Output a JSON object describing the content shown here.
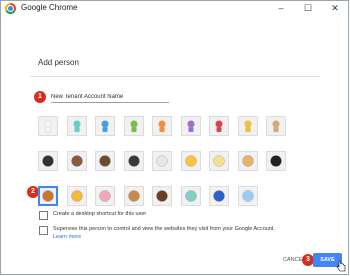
{
  "window": {
    "title": "Google Chrome",
    "controls": {
      "minimize": "–",
      "maximize": "☐",
      "close": "✕"
    }
  },
  "dialog": {
    "title": "Add person"
  },
  "name_input": {
    "value": "New Tenant Account Name"
  },
  "steps": {
    "one": "1",
    "two": "2",
    "three": "3"
  },
  "avatars": [
    {
      "icon": "white-silhouette-icon",
      "color": "#f5f5f5"
    },
    {
      "icon": "teal-silhouette-icon",
      "color": "#5fd1c4"
    },
    {
      "icon": "blue-silhouette-icon",
      "color": "#3aa0f0"
    },
    {
      "icon": "green-silhouette-icon",
      "color": "#6fc247"
    },
    {
      "icon": "orange-silhouette-icon",
      "color": "#f58c3a"
    },
    {
      "icon": "purple-silhouette-icon",
      "color": "#9b6bd6"
    },
    {
      "icon": "red-silhouette-icon",
      "color": "#e33b4a"
    },
    {
      "icon": "yellow-silhouette-icon",
      "color": "#f2c230"
    },
    {
      "icon": "tan-person-icon",
      "color": "#d8a86f"
    },
    {
      "icon": "detective-icon",
      "color": "#333333"
    },
    {
      "icon": "mustache-man-icon",
      "color": "#8a5a3c"
    },
    {
      "icon": "bearded-man-icon",
      "color": "#6b4c2f"
    },
    {
      "icon": "ninja-icon",
      "color": "#3a3a3a"
    },
    {
      "icon": "alien-icon",
      "color": "#e6e6e6"
    },
    {
      "icon": "smiley-icon",
      "color": "#f5c542"
    },
    {
      "icon": "flower-icon",
      "color": "#f4e28a"
    },
    {
      "icon": "pizza-icon",
      "color": "#e8b26b"
    },
    {
      "icon": "soccer-ball-icon",
      "color": "#222222"
    },
    {
      "icon": "burger-icon",
      "color": "#c9782f"
    },
    {
      "icon": "cat-icon",
      "color": "#f2b93a"
    },
    {
      "icon": "cupcake-icon",
      "color": "#f2a6b8"
    },
    {
      "icon": "dog-icon",
      "color": "#c98a4e"
    },
    {
      "icon": "horse-icon",
      "color": "#6b3f25"
    },
    {
      "icon": "cocktail-icon",
      "color": "#7fd1c6"
    },
    {
      "icon": "music-note-icon",
      "color": "#2a62c9"
    },
    {
      "icon": "sun-cloud-icon",
      "color": "#9ccbf0"
    }
  ],
  "options": {
    "desktop_shortcut": "Create a desktop shortcut for this user",
    "supervise": "Supervise this person to control and view the websites they visit from your Google Account.",
    "learn_more": "Learn more"
  },
  "buttons": {
    "cancel": "CANCEL",
    "save": "SAVE"
  },
  "colors": {
    "accent": "#4285f4",
    "badge": "#d62d20"
  }
}
